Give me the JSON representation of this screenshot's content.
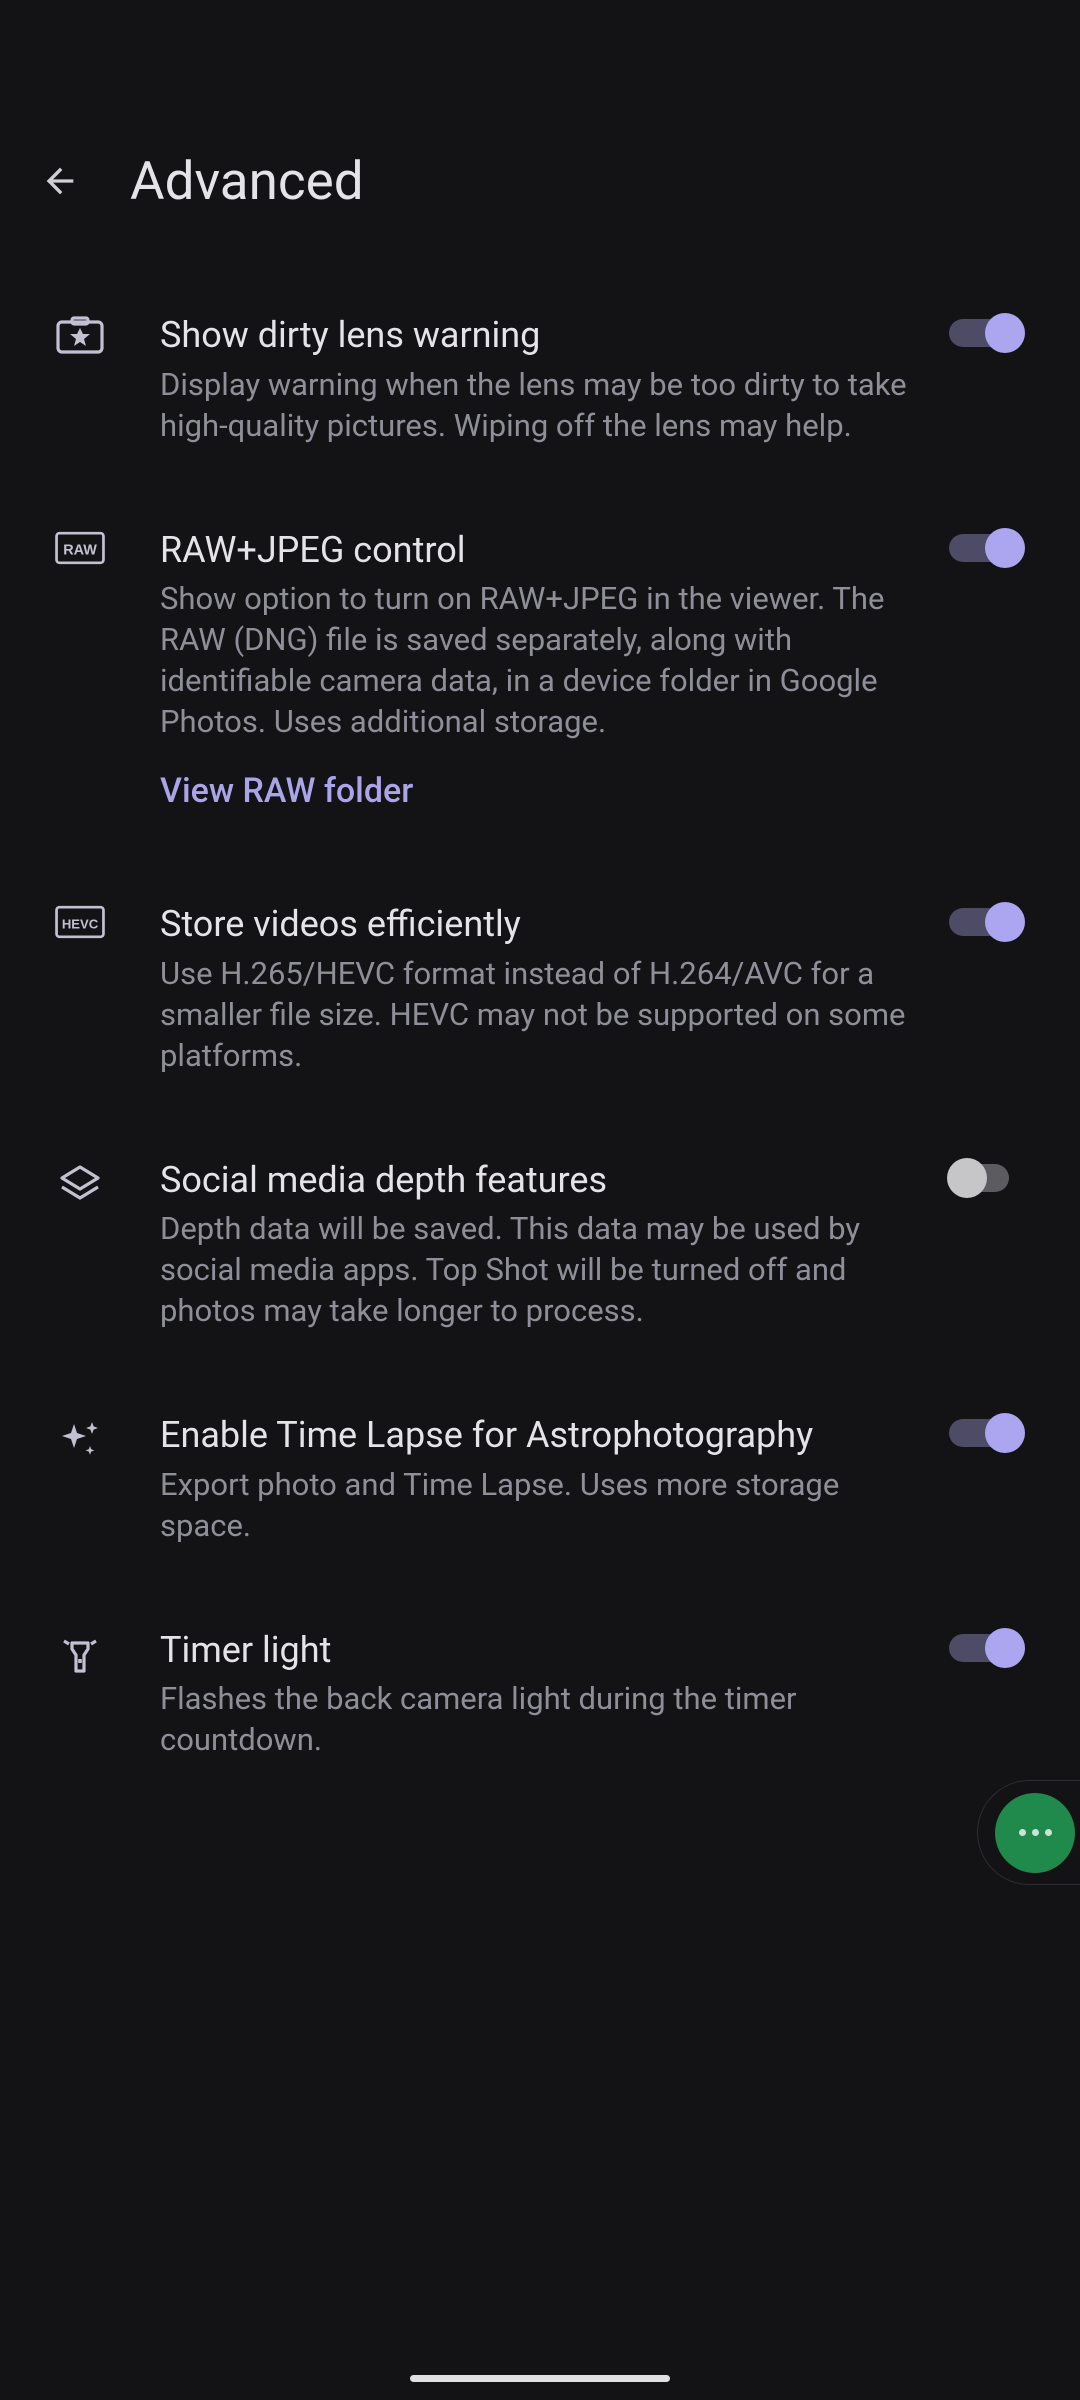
{
  "header": {
    "title": "Advanced"
  },
  "items": [
    {
      "key": "dirty-lens",
      "title": "Show dirty lens warning",
      "desc": "Display warning when the lens may be too dirty to take high-quality pictures. Wiping off the lens may help.",
      "toggle": true
    },
    {
      "key": "raw-jpeg",
      "title": "RAW+JPEG control",
      "desc": "Show option to turn on RAW+JPEG in the viewer. The RAW (DNG) file is saved separately, along with identifiable camera data, in a device folder in Google Photos. Uses additional storage.",
      "link": "View RAW folder",
      "toggle": true
    },
    {
      "key": "hevc",
      "title": "Store videos efficiently",
      "desc": "Use H.265/HEVC format instead of H.264/AVC for a smaller file size. HEVC may not be supported on some platforms.",
      "toggle": true
    },
    {
      "key": "depth",
      "title": "Social media depth features",
      "desc": "Depth data will be saved. This data may be used by social media apps. Top Shot will be turned off and photos may take longer to process.",
      "toggle": false
    },
    {
      "key": "astro",
      "title": "Enable Time Lapse for Astrophotography",
      "desc": "Export photo and Time Lapse. Uses more storage space.",
      "toggle": true
    },
    {
      "key": "timer-light",
      "title": "Timer light",
      "desc": "Flashes the back camera light during the timer countdown.",
      "toggle": true
    }
  ]
}
